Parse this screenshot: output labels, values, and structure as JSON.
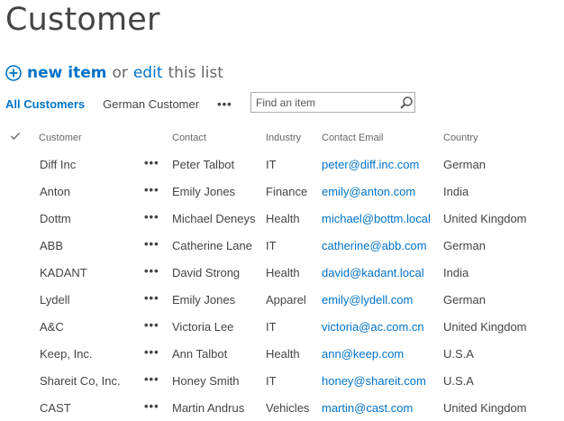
{
  "page": {
    "title": "Customer"
  },
  "actions": {
    "new_item": "new item",
    "or": "or",
    "edit": "edit",
    "this_list": "this list"
  },
  "views": {
    "active": "All Customers",
    "other": "German Customer",
    "more": "•••"
  },
  "search": {
    "placeholder": "Find an item"
  },
  "columns": [
    "Customer",
    "Contact",
    "Industry",
    "Contact Email",
    "Country"
  ],
  "row_menu": "•••",
  "rows": [
    {
      "customer": "Diff Inc",
      "contact": "Peter Talbot",
      "industry": "IT",
      "email": "peter@diff.inc.com",
      "country": "German"
    },
    {
      "customer": "Anton",
      "contact": "Emily Jones",
      "industry": "Finance",
      "email": "emily@anton.com",
      "country": "India"
    },
    {
      "customer": "Dottm",
      "contact": "Michael Deneys",
      "industry": "Health",
      "email": "michael@bottm.local",
      "country": "United Kingdom"
    },
    {
      "customer": "ABB",
      "contact": "Catherine Lane",
      "industry": "IT",
      "email": "catherine@abb.com",
      "country": "German"
    },
    {
      "customer": "KADANT",
      "contact": "David Strong",
      "industry": "Health",
      "email": "david@kadant.local",
      "country": "India"
    },
    {
      "customer": "Lydell",
      "contact": "Emily Jones",
      "industry": "Apparel",
      "email": "emily@lydell.com",
      "country": "German"
    },
    {
      "customer": "A&C",
      "contact": "Victoria Lee",
      "industry": "IT",
      "email": "victoria@ac.com.cn",
      "country": "United Kingdom"
    },
    {
      "customer": "Keep, Inc.",
      "contact": "Ann Talbot",
      "industry": "Health",
      "email": "ann@keep.com",
      "country": "U.S.A"
    },
    {
      "customer": "Shareit Co, Inc.",
      "contact": "Honey Smith",
      "industry": "IT",
      "email": "honey@shareit.com",
      "country": "U.S.A"
    },
    {
      "customer": "CAST",
      "contact": "Martin Andrus",
      "industry": "Vehicles",
      "email": "martin@cast.com",
      "country": "United Kingdom"
    }
  ]
}
